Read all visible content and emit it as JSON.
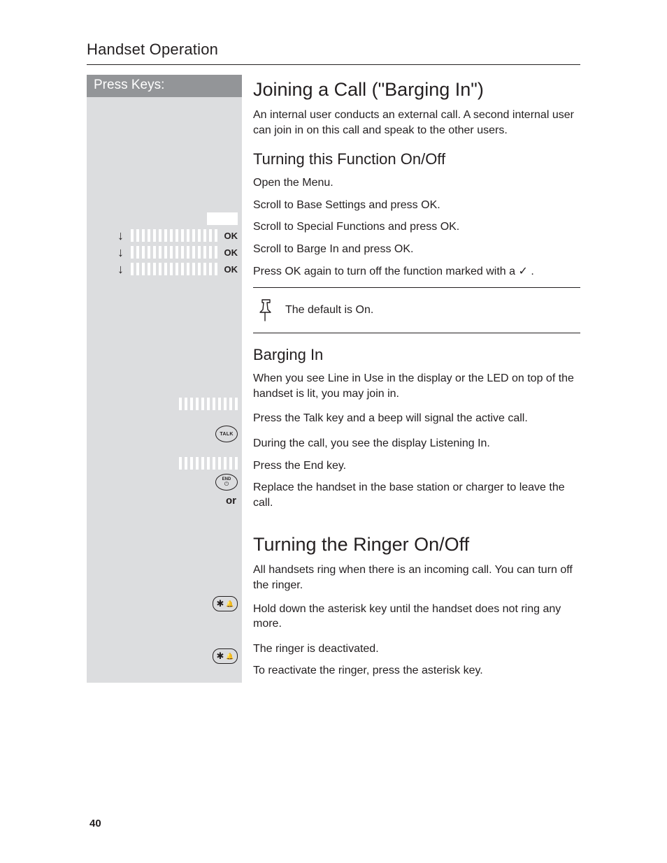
{
  "header": {
    "section": "Handset Operation",
    "page_number": "40"
  },
  "sidebar": {
    "title": "Press Keys:",
    "ok": "OK",
    "or": "or",
    "talk": "TALK",
    "end": "END"
  },
  "section1": {
    "title": "Joining a Call (\"Barging In\")",
    "intro": "An internal user conducts an external call. A second internal user can join in on this call and speak to the other users.",
    "sub1_title": "Turning this Function On/Off",
    "steps": {
      "openMenu": "Open the Menu.",
      "baseSettings": "Scroll to Base Settings and press OK.",
      "specialFunctions": "Scroll to Special Functions and press OK.",
      "bargeIn": "Scroll to Barge In and press OK.",
      "pressOkAgain_a": "Press OK again to turn off the function marked with a ",
      "pressOkAgain_b": " ."
    },
    "note": "The default is On.",
    "sub2_title": "Barging In",
    "bargeSteps": {
      "whenLine": "When you see Line in Use in the display or the LED on top of the handset is lit, you may join in.",
      "pressTalk": "Press the Talk key and a beep will signal the active call.",
      "duringCall": "During the call, you see the display Listening In.",
      "pressEnd": "Press the End key.",
      "replace": "Replace the handset in the base station or charger to leave the call."
    }
  },
  "section2": {
    "title": "Turning the Ringer On/Off",
    "intro": "All handsets ring when there is an incoming call. You can turn off the ringer.",
    "steps": {
      "holdAst": "Hold down the asterisk key until the handset does not ring any more.",
      "deactivated": "The ringer is deactivated.",
      "reactivate": "To reactivate the ringer, press the asterisk key."
    }
  }
}
